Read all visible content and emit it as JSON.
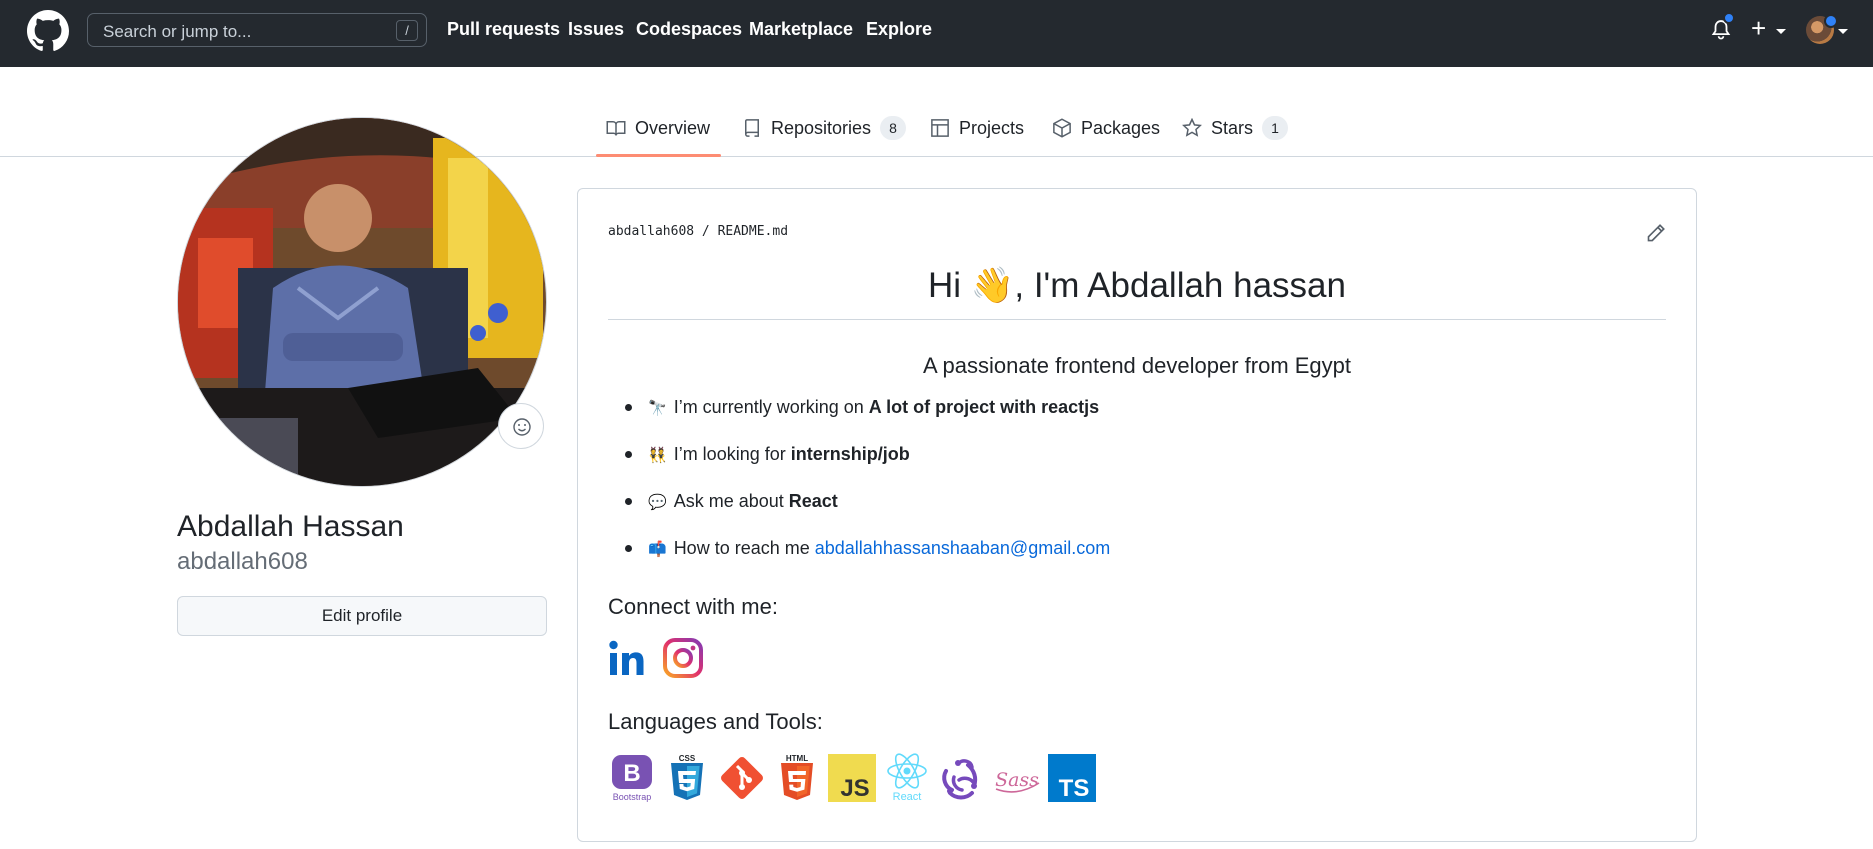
{
  "header": {
    "search_placeholder": "Search or jump to...",
    "search_shortcut": "/",
    "nav": [
      "Pull requests",
      "Issues",
      "Codespaces",
      "Marketplace",
      "Explore"
    ],
    "plus_label": "+"
  },
  "tabs": [
    {
      "label": "Overview",
      "icon": "book-icon",
      "active": true
    },
    {
      "label": "Repositories",
      "icon": "repo-icon",
      "count": "8"
    },
    {
      "label": "Projects",
      "icon": "table-icon"
    },
    {
      "label": "Packages",
      "icon": "package-icon"
    },
    {
      "label": "Stars",
      "icon": "star-icon",
      "count": "1"
    }
  ],
  "profile": {
    "full_name": "Abdallah Hassan",
    "login": "abdallah608",
    "edit_button": "Edit profile"
  },
  "readme": {
    "owner": "abdallah608",
    "separator": "/",
    "file": "README.md",
    "title_pre": "Hi ",
    "title_emoji": "👋",
    "title_post": ", I'm Abdallah hassan",
    "subtitle": "A passionate frontend developer from Egypt",
    "bullets": [
      {
        "emoji": "🔭",
        "text": "I’m currently working on",
        "strong": "A lot of project with reactjs"
      },
      {
        "emoji": "👯",
        "text": "I’m looking for",
        "strong": "internship/job"
      },
      {
        "emoji": "💬",
        "text": "Ask me about",
        "strong": "React"
      },
      {
        "emoji": "📫",
        "text": "How to reach me",
        "link": "abdallahhassanshaaban@gmail.com"
      }
    ],
    "connect_heading": "Connect with me:",
    "languages_heading": "Languages and Tools:",
    "tools": {
      "bootstrap_letter": "B",
      "bootstrap_label": "Bootstrap",
      "css_label": "CSS",
      "html_label": "HTML",
      "js_label": "JS",
      "react_label": "React",
      "sass_label": "Sass",
      "ts_label": "TS"
    }
  }
}
